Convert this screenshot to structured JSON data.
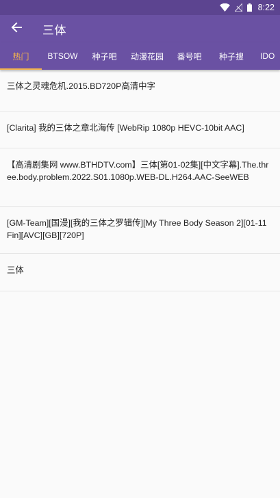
{
  "status": {
    "time": "8:22"
  },
  "appbar": {
    "title": "三体"
  },
  "tabs": [
    {
      "label": "热门"
    },
    {
      "label": "BTSOW"
    },
    {
      "label": "种子吧"
    },
    {
      "label": "动漫花园"
    },
    {
      "label": "番号吧"
    },
    {
      "label": "种子搜"
    },
    {
      "label": "IDO"
    }
  ],
  "results": [
    {
      "title": "三体之灵魂危机.2015.BD720P高清中字"
    },
    {
      "title": "[Clarita] 我的三体之章北海传 [WebRip 1080p HEVC-10bit AAC]"
    },
    {
      "title": "【高清剧集网 www.BTHDTV.com】三体[第01-02集][中文字幕].The.three.body.problem.2022.S01.1080p.WEB-DL.H264.AAC-SeeWEB"
    },
    {
      "title": "[GM-Team][国漫][我的三体之罗辑传][My Three Body Season 2][01-11 Fin][AVC][GB][720P]"
    },
    {
      "title": "三体"
    }
  ],
  "colors": {
    "primary": "#6a51a3",
    "status_bar": "#5c4490",
    "accent": "#f2b24d"
  }
}
